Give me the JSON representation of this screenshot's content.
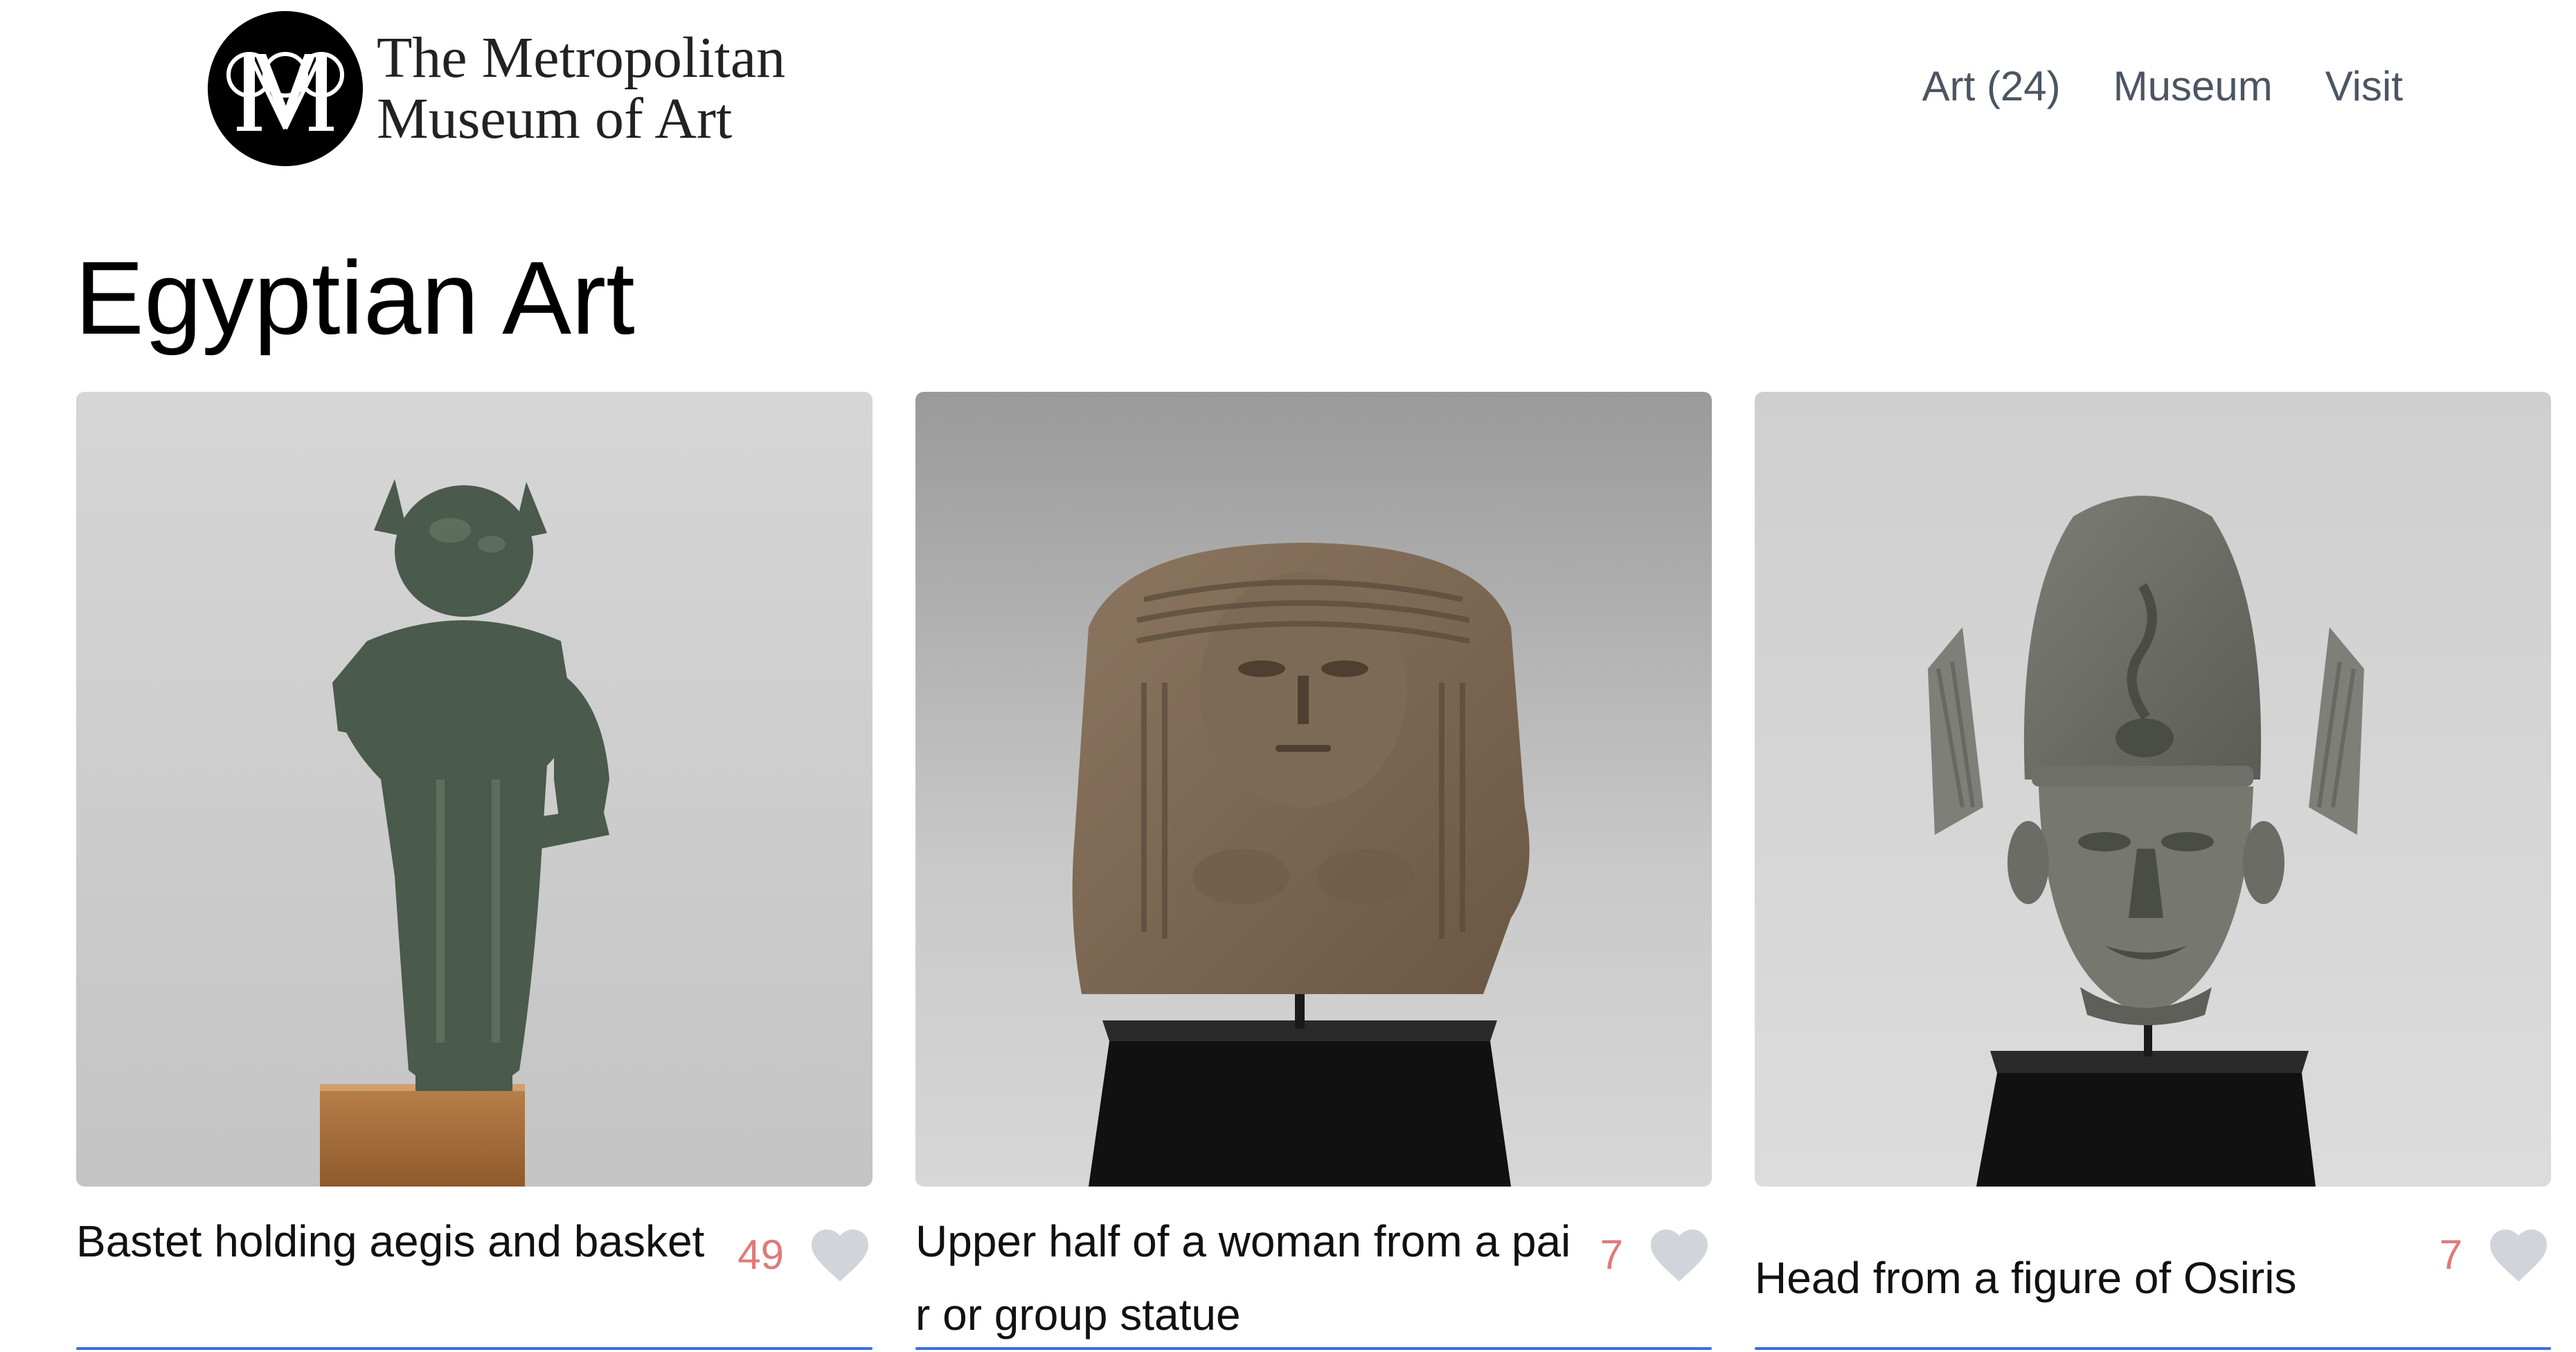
{
  "header": {
    "logo_line1": "The Metropolitan",
    "logo_line2": "Museum of Art",
    "logo_icon": "met-logo-icon",
    "nav": [
      {
        "label": "Art (24)"
      },
      {
        "label": "Museum"
      },
      {
        "label": "Visit"
      }
    ]
  },
  "page": {
    "title": "Egyptian Art"
  },
  "cards": [
    {
      "title": "Bastet holding aegis and basket",
      "likes": "49",
      "image_icon": "bastet-statue-image"
    },
    {
      "title": "Upper half of a woman from a pair or group statue",
      "likes": "7",
      "image_icon": "woman-bust-image"
    },
    {
      "title": "Head from a figure of Osiris",
      "likes": "7",
      "image_icon": "osiris-head-image"
    }
  ],
  "colors": {
    "nav_text": "#4b5563",
    "like_count": "#e07a7a",
    "heart": "#d1d5db",
    "card_rule": "#3b6fd8"
  }
}
